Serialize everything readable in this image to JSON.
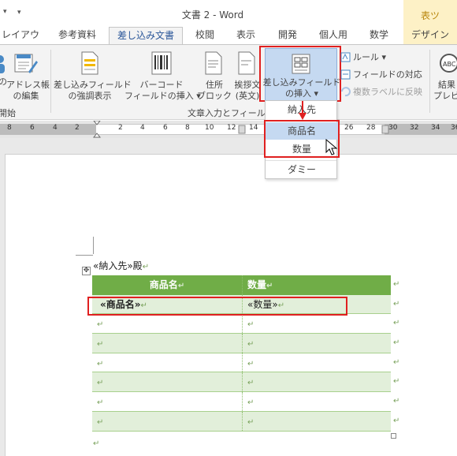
{
  "title_bar": {
    "quick_access_arrow": "▾",
    "doc_title": "文書 2 - Word",
    "context_tab_label": "表ツ"
  },
  "tabs": [
    {
      "label": "レイアウト"
    },
    {
      "label": "参考資料"
    },
    {
      "label": "差し込み文書"
    },
    {
      "label": "校閲"
    },
    {
      "label": "表示"
    },
    {
      "label": "開発"
    },
    {
      "label": "個人用"
    },
    {
      "label": "数学"
    },
    {
      "label": "デザイン"
    }
  ],
  "ribbon": {
    "left_partial_label_1": "の",
    "left_partial_label_2": "開始",
    "address_book": {
      "line1": "アドレス帳",
      "line2": "の編集"
    },
    "highlight_fields": {
      "line1": "差し込みフィールド",
      "line2": "の強調表示"
    },
    "barcode_field": {
      "line1": "バーコード",
      "line2": "フィールドの挿入 ▾"
    },
    "address_block": {
      "line1": "住所",
      "line2": "ブロック"
    },
    "greeting_line": {
      "line1": "挨拶文",
      "line2": "(英文)"
    },
    "insert_merge_field": {
      "line1": "差し込みフィールド",
      "line2": "の挿入 ▾"
    },
    "rules": "ルール ▾",
    "match_fields": "フィールドの対応",
    "update_labels": "複数ラベルに反映",
    "preview_results": {
      "line1": "結果",
      "line2": "プレビ"
    },
    "group_label_fields": "文章入力とフィールド"
  },
  "ruler": {
    "numbers": [
      "8",
      "6",
      "4",
      "2",
      "2",
      "4",
      "6",
      "8",
      "10",
      "12",
      "14",
      "26",
      "28",
      "30",
      "32",
      "34",
      "36"
    ]
  },
  "dropdown": {
    "items": [
      "納入先",
      "商品名",
      "数量",
      "ダミー"
    ]
  },
  "document": {
    "addressee_line": "«納入先»殿",
    "table": {
      "headers": [
        "商品名",
        "数量"
      ],
      "rows": [
        [
          "«商品名»",
          "«数量»"
        ],
        [
          "",
          ""
        ],
        [
          "",
          ""
        ],
        [
          "",
          ""
        ],
        [
          "",
          ""
        ],
        [
          "",
          ""
        ],
        [
          "",
          ""
        ]
      ]
    },
    "cell_mark": "↵",
    "row_end_mark": "↵",
    "paragraph_mark": "↵"
  },
  "colors": {
    "accent_blue": "#2b579a",
    "table_header": "#70ad47",
    "table_band": "#e2efda",
    "highlight_red": "#e02020",
    "selected_button": "#c5d9f1"
  }
}
